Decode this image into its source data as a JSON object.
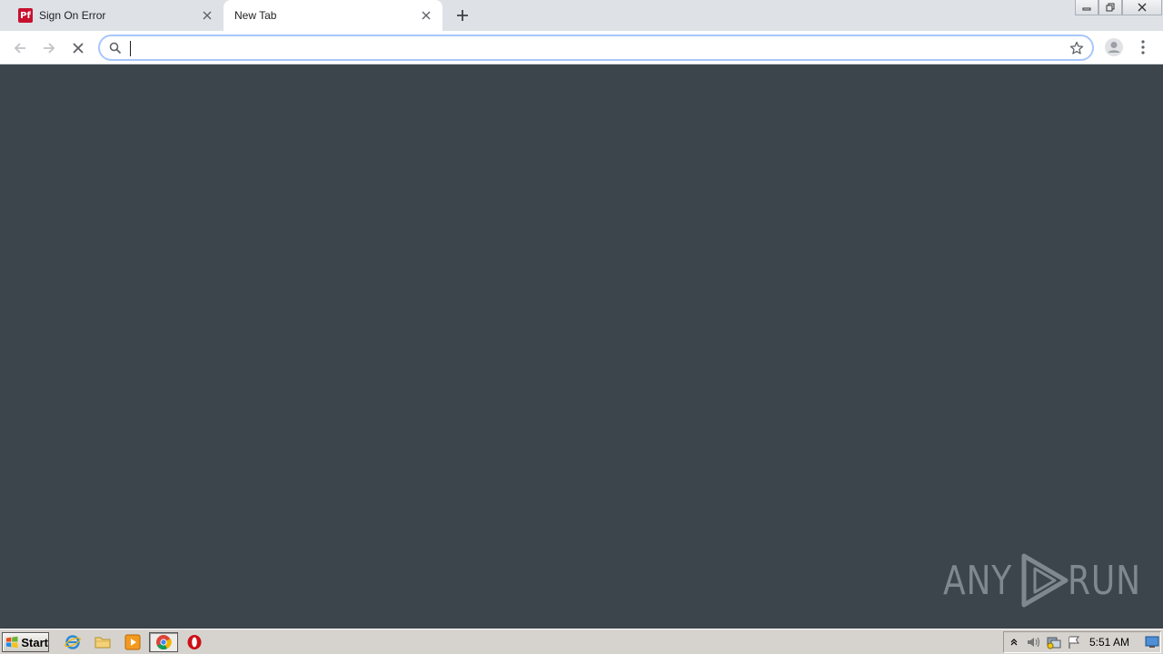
{
  "browser": {
    "tabs": [
      {
        "title": "Sign On Error",
        "favicon_text": "Pf",
        "active": false
      },
      {
        "title": "New Tab",
        "active": true
      }
    ],
    "omnibox": {
      "value": "",
      "placeholder": ""
    },
    "icons": {
      "back": "arrow-left-icon",
      "forward": "arrow-right-icon",
      "stop": "close-icon",
      "search": "search-icon",
      "bookmark": "star-icon",
      "profile": "person-icon",
      "menu": "kebab-icon",
      "new_tab": "plus-icon"
    }
  },
  "watermark": {
    "left": "ANY",
    "right": "RUN"
  },
  "taskbar": {
    "start_label": "Start",
    "pinned": [
      "internet-explorer-icon",
      "folder-icon",
      "media-player-icon",
      "chrome-icon",
      "opera-icon"
    ],
    "clock": "5:51 AM"
  },
  "colors": {
    "tabstrip": "#dee1e6",
    "page_background": "#3c444c",
    "omnibox_focus": "#a8c7fa",
    "taskbar": "#d6d3ce"
  }
}
